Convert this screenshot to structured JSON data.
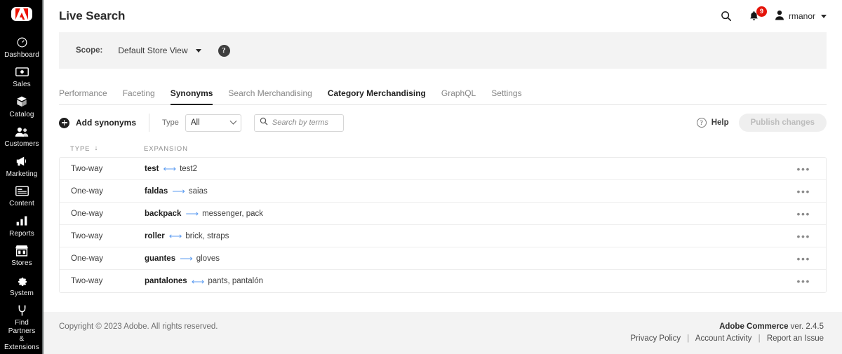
{
  "sidebar": {
    "logo": "adobe-logo",
    "items": [
      {
        "label": "Dashboard",
        "icon": "dashboard-icon"
      },
      {
        "label": "Sales",
        "icon": "sales-icon"
      },
      {
        "label": "Catalog",
        "icon": "catalog-icon"
      },
      {
        "label": "Customers",
        "icon": "customers-icon"
      },
      {
        "label": "Marketing",
        "icon": "marketing-icon"
      },
      {
        "label": "Content",
        "icon": "content-icon"
      },
      {
        "label": "Reports",
        "icon": "reports-icon"
      },
      {
        "label": "Stores",
        "icon": "stores-icon"
      },
      {
        "label": "System",
        "icon": "system-icon"
      },
      {
        "label": "Find Partners\n& Extensions",
        "icon": "find-partners-icon"
      }
    ]
  },
  "header": {
    "title": "Live Search",
    "search_icon": "search-icon",
    "notifications_icon": "bell-icon",
    "notifications_count": "9",
    "user_icon": "user-avatar-icon",
    "user_name": "rmanor"
  },
  "scope": {
    "label": "Scope:",
    "value": "Default Store View",
    "help_icon": "question-mark-icon"
  },
  "tabs": [
    {
      "label": "Performance",
      "state": "inactive"
    },
    {
      "label": "Faceting",
      "state": "inactive"
    },
    {
      "label": "Synonyms",
      "state": "active"
    },
    {
      "label": "Search Merchandising",
      "state": "inactive"
    },
    {
      "label": "Category Merchandising",
      "state": "dark"
    },
    {
      "label": "GraphQL",
      "state": "inactive"
    },
    {
      "label": "Settings",
      "state": "inactive"
    }
  ],
  "toolbar": {
    "add_label": "Add synonyms",
    "add_icon": "plus-circle-icon",
    "type_label": "Type",
    "type_value": "All",
    "search_placeholder": "Search by terms",
    "search_value": "",
    "search_icon": "search-icon",
    "help_label": "Help",
    "help_icon": "question-circle-icon",
    "publish_label": "Publish changes",
    "publish_disabled": true
  },
  "table": {
    "columns": [
      {
        "key": "type",
        "label": "TYPE",
        "sorted": true,
        "sort_dir": "desc",
        "sort_glyph": "↓"
      },
      {
        "key": "expansion",
        "label": "EXPANSION",
        "sorted": false
      }
    ],
    "row_menu_icon": "overflow-menu-icon",
    "row_menu_glyph": "•••",
    "rows": [
      {
        "type": "Two-way",
        "term": "test",
        "arrow": "⟷",
        "targets": "test2"
      },
      {
        "type": "One-way",
        "term": "faldas",
        "arrow": "⟶",
        "targets": "saias"
      },
      {
        "type": "One-way",
        "term": "backpack",
        "arrow": "⟶",
        "targets": "messenger, pack"
      },
      {
        "type": "Two-way",
        "term": "roller",
        "arrow": "⟷",
        "targets": "brick, straps"
      },
      {
        "type": "One-way",
        "term": "guantes",
        "arrow": "⟶",
        "targets": "gloves"
      },
      {
        "type": "Two-way",
        "term": "pantalones",
        "arrow": "⟷",
        "targets": "pants, pantalón"
      }
    ]
  },
  "footer": {
    "copyright": "Copyright © 2023 Adobe. All rights reserved.",
    "product": "Adobe Commerce",
    "version": " ver. 2.4.5",
    "links": [
      {
        "label": "Privacy Policy"
      },
      {
        "label": "Account Activity"
      },
      {
        "label": "Report an Issue"
      }
    ],
    "separator": "|"
  },
  "colors": {
    "sidebar_bg": "#000000",
    "accent_red": "#e4140a",
    "arrow_blue": "#5b9bf0",
    "panel_grey": "#f3f3f3"
  }
}
